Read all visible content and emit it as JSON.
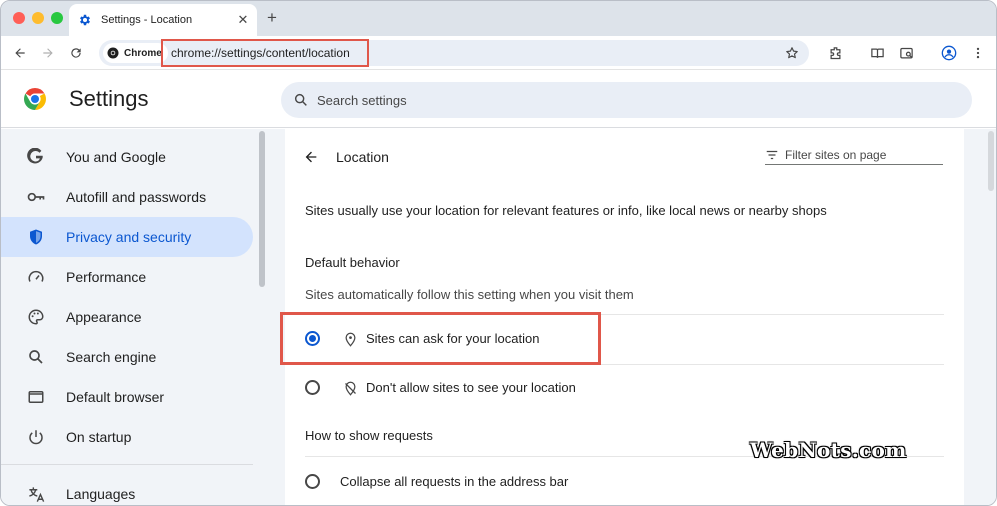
{
  "tab": {
    "title": "Settings - Location",
    "close": "✕",
    "new_tab": "+"
  },
  "toolbar": {
    "chip_label": "Chrome",
    "url": "chrome://settings/content/location"
  },
  "header": {
    "title": "Settings",
    "search_placeholder": "Search settings"
  },
  "sidebar": {
    "items": [
      {
        "label": "You and Google",
        "icon": "google-g-icon"
      },
      {
        "label": "Autofill and passwords",
        "icon": "key-icon"
      },
      {
        "label": "Privacy and security",
        "icon": "shield-icon",
        "active": true
      },
      {
        "label": "Performance",
        "icon": "speedometer-icon"
      },
      {
        "label": "Appearance",
        "icon": "palette-icon"
      },
      {
        "label": "Search engine",
        "icon": "search-icon"
      },
      {
        "label": "Default browser",
        "icon": "browser-window-icon"
      },
      {
        "label": "On startup",
        "icon": "power-icon"
      },
      {
        "label": "Languages",
        "icon": "translate-icon"
      }
    ]
  },
  "main": {
    "title": "Location",
    "filter_placeholder": "Filter sites on page",
    "description": "Sites usually use your location for relevant features or info, like local news or nearby shops",
    "default_behavior": {
      "heading": "Default behavior",
      "subtext": "Sites automatically follow this setting when you visit them",
      "options": [
        {
          "label": "Sites can ask for your location",
          "selected": true,
          "icon": "location-pin-icon"
        },
        {
          "label": "Don't allow sites to see your location",
          "selected": false,
          "icon": "location-off-icon"
        }
      ]
    },
    "requests": {
      "heading": "How to show requests",
      "options": [
        {
          "label": "Collapse all requests in the address bar",
          "selected": false
        }
      ]
    }
  },
  "watermark": "WebNots.com",
  "colors": {
    "accent": "#0b57d0",
    "active_bg": "#d3e3fd",
    "highlight": "#e0574a"
  }
}
